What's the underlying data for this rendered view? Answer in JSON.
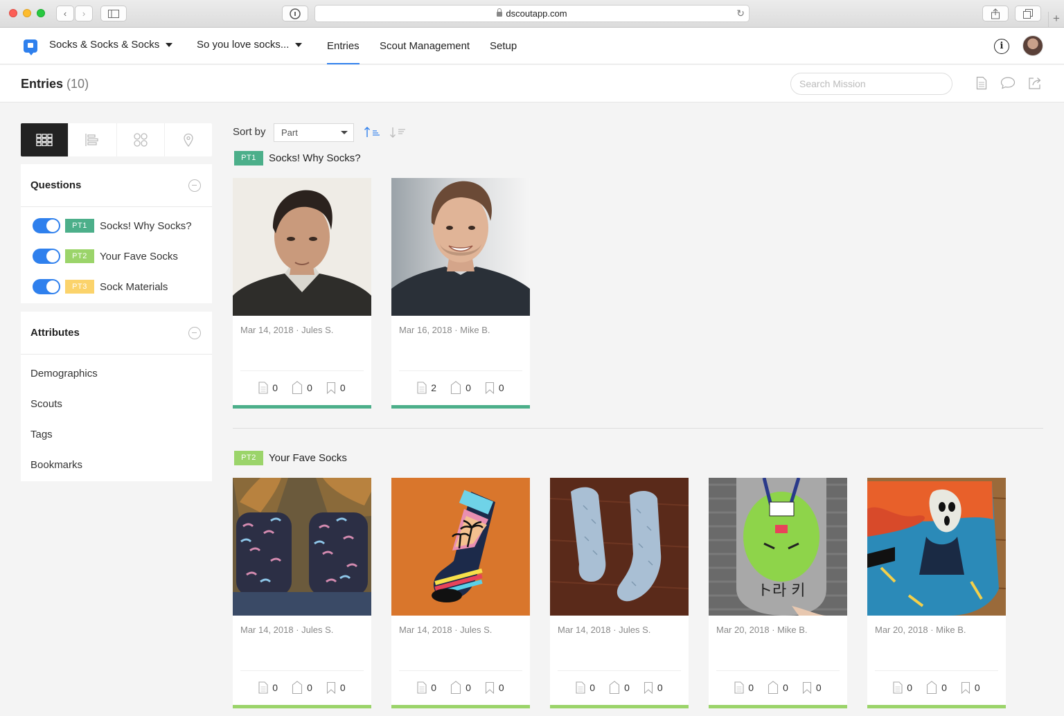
{
  "browser": {
    "url": "dscoutapp.com"
  },
  "nav": {
    "project": "Socks & Socks & Socks",
    "mission": "So you love socks...",
    "links": [
      "Entries",
      "Scout Management",
      "Setup"
    ],
    "active_link": "Entries"
  },
  "subheader": {
    "title": "Entries",
    "count": "(10)",
    "search_placeholder": "Search Mission"
  },
  "sidebar": {
    "questions": {
      "title": "Questions",
      "items": [
        {
          "badge": "PT1",
          "label": "Socks! Why Socks?",
          "color": "#4caf8a",
          "enabled": true
        },
        {
          "badge": "PT2",
          "label": "Your Fave Socks",
          "color": "#9bd46a",
          "enabled": true
        },
        {
          "badge": "PT3",
          "label": "Sock Materials",
          "color": "#fbd36b",
          "enabled": true
        }
      ]
    },
    "attributes": {
      "title": "Attributes",
      "items": [
        "Demographics",
        "Scouts",
        "Tags",
        "Bookmarks"
      ]
    }
  },
  "sort": {
    "label": "Sort by",
    "selected": "Part"
  },
  "sections": [
    {
      "badge": "PT1",
      "title": "Socks! Why Socks?",
      "color": "#4caf8a",
      "entries": [
        {
          "meta": "Mar 14, 2018 · Jules S.",
          "notes": "0",
          "clips": "0",
          "bookmarks": "0",
          "image": "portrait-jules"
        },
        {
          "meta": "Mar 16, 2018 · Mike B.",
          "notes": "2",
          "clips": "0",
          "bookmarks": "0",
          "image": "portrait-mike"
        }
      ]
    },
    {
      "badge": "PT2",
      "title": "Your Fave Socks",
      "color": "#9bd46a",
      "entries": [
        {
          "meta": "Mar 14, 2018 · Jules S.",
          "notes": "0",
          "clips": "0",
          "bookmarks": "0",
          "image": "socks-on-feet"
        },
        {
          "meta": "Mar 14, 2018 · Jules S.",
          "notes": "0",
          "clips": "0",
          "bookmarks": "0",
          "image": "palm-tree-sock"
        },
        {
          "meta": "Mar 14, 2018 · Jules S.",
          "notes": "0",
          "clips": "0",
          "bookmarks": "0",
          "image": "blue-socks-on-wood"
        },
        {
          "meta": "Mar 20, 2018 · Mike B.",
          "notes": "0",
          "clips": "0",
          "bookmarks": "0",
          "image": "green-character-sock"
        },
        {
          "meta": "Mar 20, 2018 · Mike B.",
          "notes": "0",
          "clips": "0",
          "bookmarks": "0",
          "image": "scream-painting-sock"
        }
      ]
    }
  ]
}
